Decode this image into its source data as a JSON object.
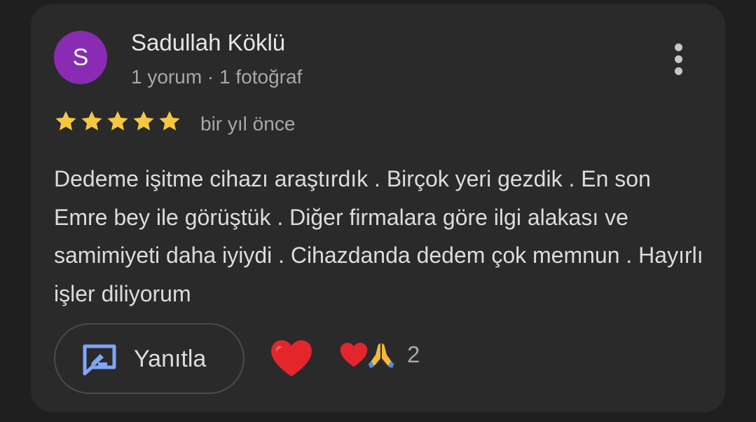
{
  "review": {
    "author": {
      "initial": "S",
      "name": "Sadullah Köklü",
      "meta": "1 yorum · 1 fotoğraf",
      "avatar_color": "#8a2bb3"
    },
    "rating": 5,
    "date": "bir yıl önce",
    "text": "Dedeme işitme cihazı araştırdık . Birçok yeri gezdik . En son Emre bey ile görüştük . Diğer firmalara göre ilgi alakası ve samimiyeti daha iyiydi . Cihazdanda dedem çok memnun . Hayırlı işler diliyorum",
    "actions": {
      "reply_label": "Yanıtla",
      "reply_icon": "reply-edit-icon",
      "react_icon": "red-heart-icon"
    },
    "reactions": {
      "icons": [
        "red-heart-icon",
        "folded-hands-icon"
      ],
      "count": "2"
    },
    "colors": {
      "star": "#f5c842",
      "accent_icon": "#7fa6f7",
      "heart": "#e3262c"
    }
  }
}
